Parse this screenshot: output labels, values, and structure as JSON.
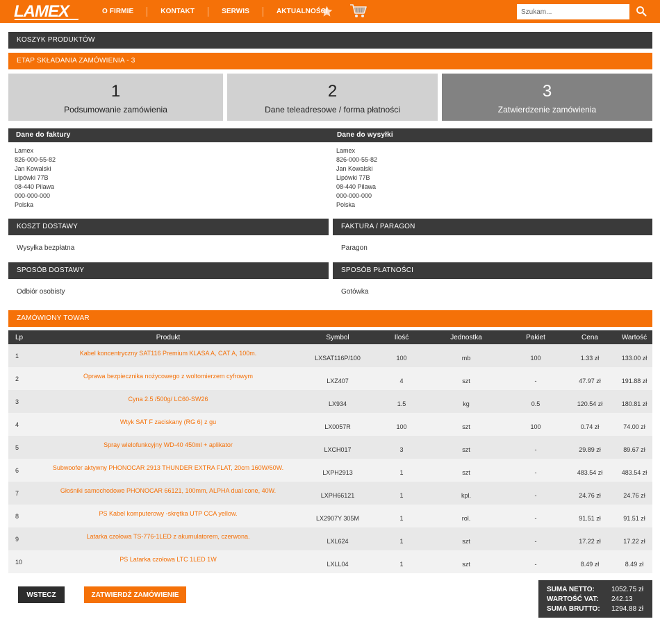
{
  "brand": {
    "logo_text": "LAMEX",
    "accent": "#f57108",
    "dark": "#3a3a3a"
  },
  "nav": {
    "items": [
      "O FIRMIE",
      "KONTAKT",
      "SERWIS",
      "AKTUALNOŚCI"
    ],
    "icons": [
      "star-icon",
      "cart-icon"
    ]
  },
  "search": {
    "placeholder": "Szukam...",
    "icon": "search-icon"
  },
  "sections": {
    "cart": "KOSZYK PRODUKTÓW",
    "stage": "ETAP SKŁADANIA ZAMÓWIENIA - 3"
  },
  "steps": [
    {
      "num": "1",
      "label": "Podsumowanie zamówienia",
      "active": false
    },
    {
      "num": "2",
      "label": "Dane teleadresowe / forma płatności",
      "active": false
    },
    {
      "num": "3",
      "label": "Zatwierdzenie zamówienia",
      "active": true
    }
  ],
  "invoice": {
    "title": "Dane do faktury",
    "lines": [
      "Lamex",
      "826-000-55-82",
      "Jan Kowalski",
      "Lipówki 77B",
      "08-440 Pilawa",
      "000-000-000",
      "Polska"
    ]
  },
  "shipping_address": {
    "title": "Dane do wysyłki",
    "lines": [
      "Lamex",
      "826-000-55-82",
      "Jan Kowalski",
      "Lipówki 77B",
      "08-440 Pilawa",
      "000-000-000",
      "Polska"
    ]
  },
  "delivery_cost": {
    "title": "KOSZT DOSTAWY",
    "value": "Wysyłka bezpłatna"
  },
  "document": {
    "title": "FAKTURA / PARAGON",
    "value": "Paragon"
  },
  "delivery_method": {
    "title": "SPOSÓB DOSTAWY",
    "value": "Odbiór osobisty"
  },
  "payment_method": {
    "title": "SPOSÓB PŁATNOŚCI",
    "value": "Gotówka"
  },
  "ordered": {
    "title": "ZAMÓWIONY TOWAR",
    "columns": [
      "Lp",
      "Produkt",
      "Symbol",
      "Ilość",
      "Jednostka",
      "Pakiet",
      "Cena",
      "Wartość"
    ],
    "rows": [
      {
        "lp": "1",
        "product": "Kabel koncentryczny SAT116 Premium KLASA A, CAT A, 100m.",
        "symbol": "LXSAT116P/100",
        "qty": "100",
        "unit": "mb",
        "pack": "100",
        "price": "1.33 zł",
        "value": "133.00 zł"
      },
      {
        "lp": "2",
        "product": "Oprawa bezpiecznika nożycowego z woltomierzem cyfrowym",
        "symbol": "LXZ407",
        "qty": "4",
        "unit": "szt",
        "pack": "-",
        "price": "47.97 zł",
        "value": "191.88 zł"
      },
      {
        "lp": "3",
        "product": "Cyna 2.5 /500g/ LC60-SW26",
        "symbol": "LX934",
        "qty": "1.5",
        "unit": "kg",
        "pack": "0.5",
        "price": "120.54 zł",
        "value": "180.81 zł"
      },
      {
        "lp": "4",
        "product": "Wtyk SAT F zaciskany (RG 6) z gu",
        "symbol": "LX0057R",
        "qty": "100",
        "unit": "szt",
        "pack": "100",
        "price": "0.74 zł",
        "value": "74.00 zł"
      },
      {
        "lp": "5",
        "product": "Spray wielofunkcyjny WD-40 450ml + aplikator",
        "symbol": "LXCH017",
        "qty": "3",
        "unit": "szt",
        "pack": "-",
        "price": "29.89 zł",
        "value": "89.67 zł"
      },
      {
        "lp": "6",
        "product": "Subwoofer aktywny PHONOCAR 2913 THUNDER EXTRA FLAT, 20cm 160W/60W.",
        "symbol": "LXPH2913",
        "qty": "1",
        "unit": "szt",
        "pack": "-",
        "price": "483.54 zł",
        "value": "483.54 zł"
      },
      {
        "lp": "7",
        "product": "Głośniki samochodowe PHONOCAR 66121, 100mm, ALPHA dual cone, 40W.",
        "symbol": "LXPH66121",
        "qty": "1",
        "unit": "kpl.",
        "pack": "-",
        "price": "24.76 zł",
        "value": "24.76 zł"
      },
      {
        "lp": "8",
        "product": "PS Kabel komputerowy -skrętka UTP CCA yellow.",
        "symbol": "LX2907Y 305M",
        "qty": "1",
        "unit": "rol.",
        "pack": "-",
        "price": "91.51 zł",
        "value": "91.51 zł"
      },
      {
        "lp": "9",
        "product": "Latarka czołowa TS-776-1LED z akumulatorem, czerwona.",
        "symbol": "LXL624",
        "qty": "1",
        "unit": "szt",
        "pack": "-",
        "price": "17.22 zł",
        "value": "17.22 zł"
      },
      {
        "lp": "10",
        "product": "PS Latarka czołowa LTC 1LED 1W",
        "symbol": "LXLL04",
        "qty": "1",
        "unit": "szt",
        "pack": "-",
        "price": "8.49 zł",
        "value": "8.49 zł"
      }
    ]
  },
  "buttons": {
    "back": "WSTECZ",
    "confirm": "ZATWIERDŹ ZAMÓWIENIE"
  },
  "summary": {
    "net_label": "SUMA NETTO:",
    "net": "1052.75 zł",
    "vat_label": "WARTOŚĆ VAT:",
    "vat": "242.13",
    "gross_label": "SUMA BRUTTO:",
    "gross": "1294.88 zł"
  }
}
